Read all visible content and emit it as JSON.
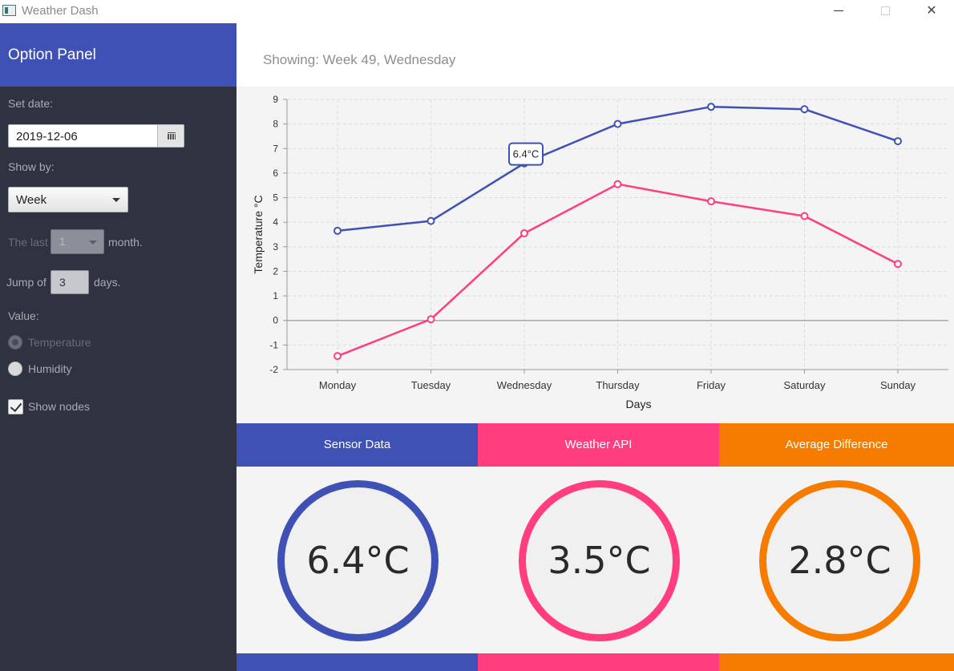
{
  "window": {
    "title": "Weather Dash"
  },
  "sidebar": {
    "title": "Option Panel",
    "set_date_label": "Set date:",
    "date_value": "2019-12-06",
    "show_by_label": "Show by:",
    "show_by_value": "Week",
    "last_prefix": "The last",
    "last_value": "1",
    "last_suffix": "month.",
    "jump_prefix": "Jump of",
    "jump_value": "3",
    "jump_suffix": "days.",
    "value_label": "Value:",
    "radio_temperature": "Temperature",
    "radio_humidity": "Humidity",
    "show_nodes_label": "Show nodes",
    "show_nodes_checked": true
  },
  "main": {
    "showing_text": "Showing: Week 49, Wednesday"
  },
  "chart_data": {
    "type": "line",
    "title": "",
    "xlabel": "Days",
    "ylabel": "Temperature °C",
    "categories": [
      "Monday",
      "Tuesday",
      "Wednesday",
      "Thursday",
      "Friday",
      "Saturday",
      "Sunday"
    ],
    "ylim": [
      -2,
      9
    ],
    "yticks": [
      -2,
      -1,
      0,
      1,
      2,
      3,
      4,
      5,
      6,
      7,
      8,
      9
    ],
    "grid": true,
    "series": [
      {
        "values": [
          3.65,
          4.05,
          6.4,
          8.0,
          8.7,
          8.6,
          7.3
        ],
        "color": "#3f51b5"
      },
      {
        "values": [
          -1.45,
          0.05,
          3.55,
          5.55,
          4.85,
          4.25,
          2.3
        ],
        "color": "#ff3d7f"
      }
    ],
    "tooltip": {
      "text": "6.4°C",
      "series": 0,
      "category": "Wednesday"
    }
  },
  "tabs": {
    "sensor": "Sensor Data",
    "api": "Weather API",
    "avg": "Average Difference"
  },
  "gauges": {
    "sensor": "6.4°C",
    "api": "3.5°C",
    "avg": "2.8°C"
  },
  "colors": {
    "sensor": "#3f51b5",
    "api": "#ff3d7f",
    "avg": "#f57c00",
    "sidebar": "#2f3240"
  },
  "icons": {
    "calendar": "calendar-icon",
    "dropdown": "chevron-down-icon"
  }
}
